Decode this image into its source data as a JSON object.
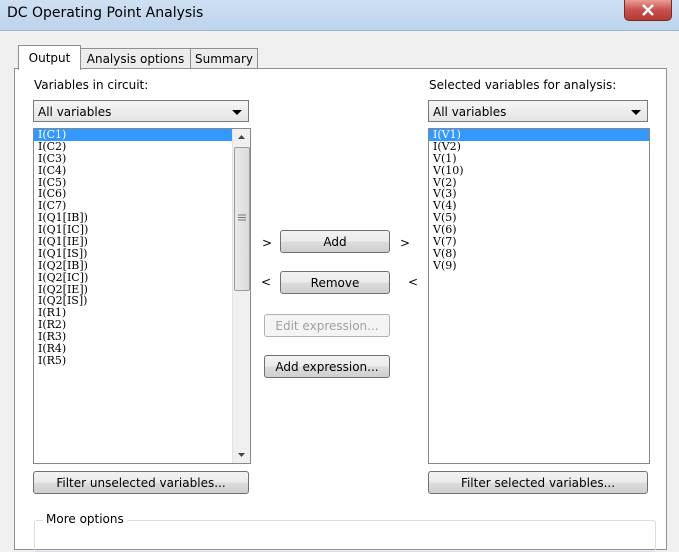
{
  "window": {
    "title": "DC Operating Point Analysis",
    "close_label": "×"
  },
  "tabs": [
    "Output",
    "Analysis options",
    "Summary"
  ],
  "left": {
    "label": "Variables in circuit:",
    "filter_value": "All variables",
    "items": [
      "I(C1)",
      "I(C2)",
      "I(C3)",
      "I(C4)",
      "I(C5)",
      "I(C6)",
      "I(C7)",
      "I(Q1[IB])",
      "I(Q1[IC])",
      "I(Q1[IE])",
      "I(Q1[IS])",
      "I(Q2[IB])",
      "I(Q2[IC])",
      "I(Q2[IE])",
      "I(Q2[IS])",
      "I(R1)",
      "I(R2)",
      "I(R3)",
      "I(R4)",
      "I(R5)"
    ],
    "filter_button": "Filter unselected variables..."
  },
  "right": {
    "label": "Selected variables for analysis:",
    "filter_value": "All variables",
    "items": [
      "I(V1)",
      "I(V2)",
      "V(1)",
      "V(10)",
      "V(2)",
      "V(3)",
      "V(4)",
      "V(5)",
      "V(6)",
      "V(7)",
      "V(8)",
      "V(9)"
    ],
    "filter_button": "Filter selected variables..."
  },
  "buttons": {
    "add": "Add",
    "remove": "Remove",
    "edit_expression": "Edit expression...",
    "add_expression": "Add expression...",
    "add_left_mark": ">",
    "add_right_mark": ">",
    "remove_left_mark": "<",
    "remove_right_mark": "<"
  },
  "more_options": "More options",
  "colors": {
    "selection": "#3399ff",
    "close_button": "#c75050"
  }
}
